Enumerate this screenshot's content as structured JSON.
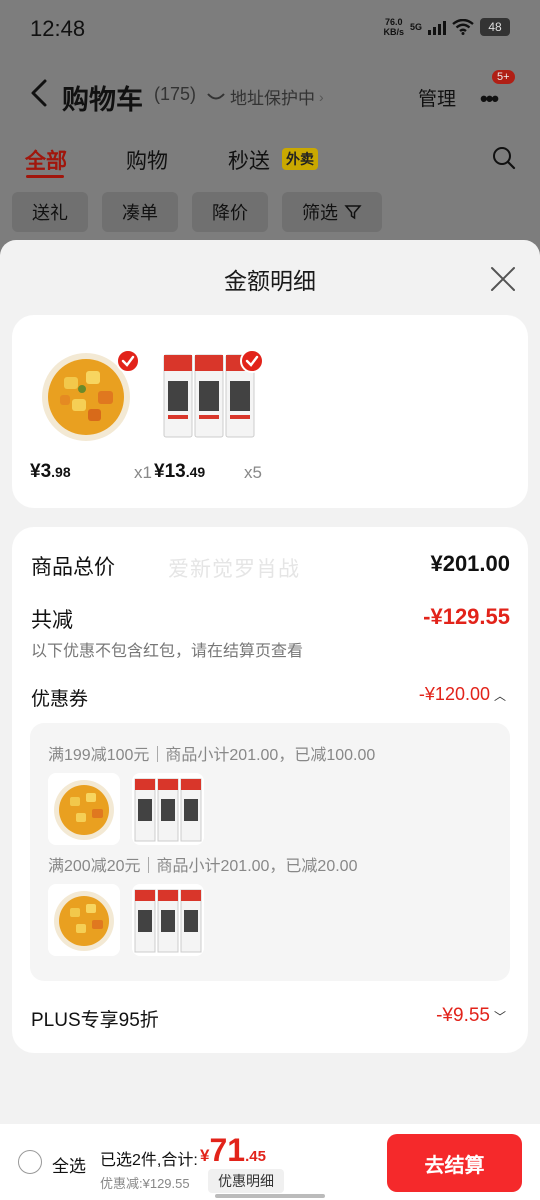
{
  "status_bar": {
    "time": "12:48",
    "net_speed_top": "76.0",
    "net_speed_unit": "KB/s",
    "network": "5G",
    "battery": "48"
  },
  "nav": {
    "title": "购物车",
    "count": "(175)",
    "address_protect": "地址保护中",
    "manage": "管理",
    "badge": "5+"
  },
  "tabs": [
    {
      "label": "全部"
    },
    {
      "label": "购物"
    },
    {
      "label": "秒送"
    }
  ],
  "takeout_badge": "外卖",
  "chips": [
    "送礼",
    "凑单",
    "降价",
    "筛选"
  ],
  "sheet": {
    "title": "金额明细",
    "products": [
      {
        "price_int": "¥3",
        "price_dec": ".98",
        "qty": "x1",
        "icon": "curry-bowl-icon"
      },
      {
        "price_int": "¥13",
        "price_dec": ".49",
        "qty": "x5",
        "icon": "birch-juice-icon"
      }
    ],
    "total_label": "商品总价",
    "total_value": "¥201.00",
    "watermark": "爱新觉罗肖战",
    "reduce_label": "共减",
    "reduce_value": "-¥129.55",
    "reduce_note": "以下优惠不包含红包，请在结算页查看",
    "coupon_label": "优惠券",
    "coupon_value": "-¥120.00",
    "coupons": [
      {
        "text": "满199减100元｜商品小计201.00，已减100.00"
      },
      {
        "text": "满200减20元｜商品小计201.00，已减20.00"
      }
    ],
    "plus_label": "PLUS专享95折",
    "plus_value": "-¥9.55"
  },
  "bottom": {
    "select_all": "全选",
    "selected_text": "已选2件,合计:",
    "total_cur": "¥",
    "total_int": "71",
    "total_dec": ".45",
    "discount_text": "优惠减:¥129.55",
    "detail_button": "优惠明细",
    "checkout": "去结算"
  },
  "colors": {
    "accent_red": "#e2231a",
    "checkout_bg": "#f5292b"
  }
}
